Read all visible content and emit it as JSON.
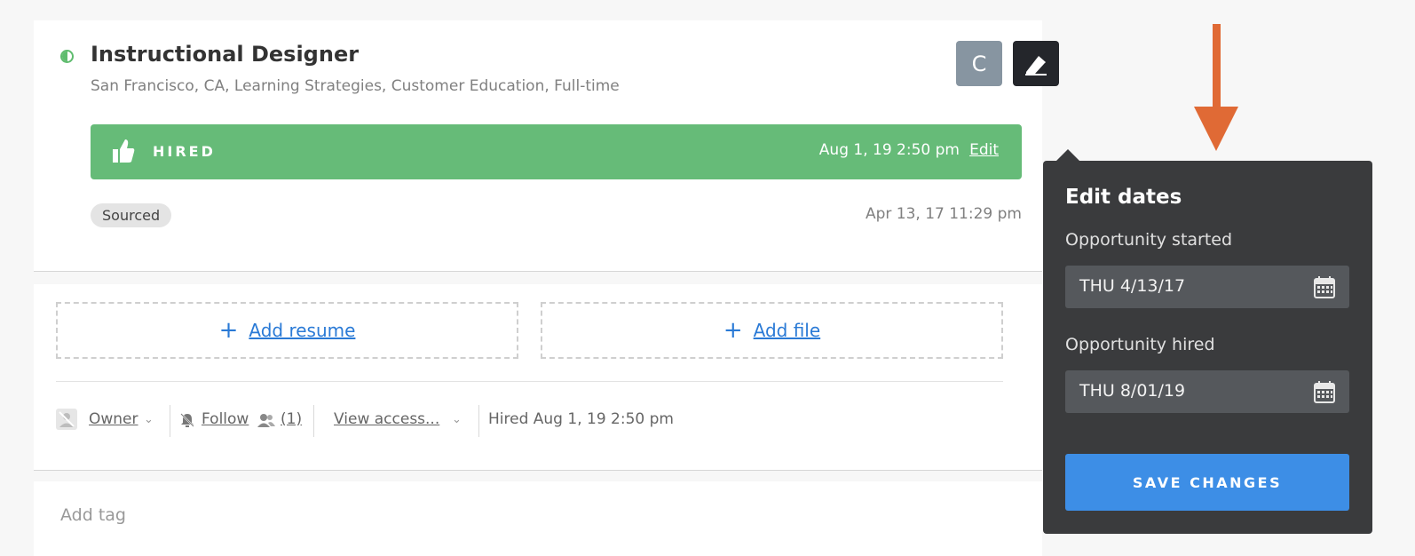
{
  "job": {
    "title": "Instructional Designer",
    "subtitle": "San Francisco, CA, Learning Strategies, Customer Education, Full-time",
    "avatar_letter": "C"
  },
  "stage_bar": {
    "label": "HIRED",
    "date": "Aug 1, 19 2:50 pm",
    "edit_label": "Edit"
  },
  "source": {
    "pill": "Sourced",
    "date": "Apr 13, 17 11:29 pm"
  },
  "attachments": {
    "resume_label": "Add resume",
    "file_label": "Add file"
  },
  "toolbar": {
    "owner_label": "Owner",
    "follow_label": "Follow",
    "followers_count": "(1)",
    "view_access_label": "View access...",
    "status_text": "Hired Aug 1, 19 2:50 pm"
  },
  "tags": {
    "placeholder": "Add tag"
  },
  "popover": {
    "title": "Edit dates",
    "started_label": "Opportunity started",
    "started_value": "THU 4/13/17",
    "hired_label": "Opportunity hired",
    "hired_value": "THU 8/01/19",
    "save_label": "SAVE CHANGES"
  },
  "colors": {
    "hired_green": "#66bb78",
    "link_blue": "#2a7ad6",
    "save_blue": "#3d8ee6",
    "popover_bg": "#3a3b3d",
    "annotation_arrow": "#e06a35"
  }
}
